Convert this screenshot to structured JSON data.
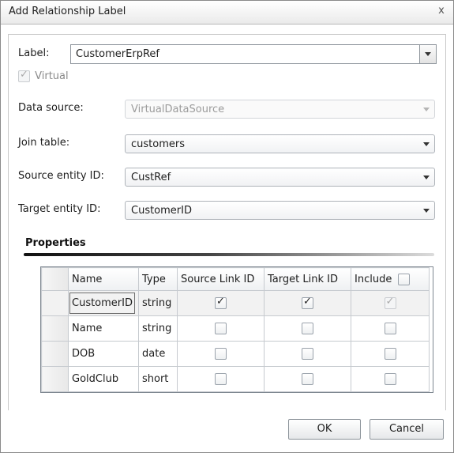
{
  "window": {
    "title": "Add Relationship Label",
    "close_glyph": "x"
  },
  "form": {
    "label_caption": "Label:",
    "label_value": "CustomerErpRef",
    "virtual_label": "Virtual",
    "virtual_checked": true,
    "data_source_caption": "Data source:",
    "data_source_value": "VirtualDataSource",
    "join_table_caption": "Join table:",
    "join_table_value": "customers",
    "source_entity_caption": "Source entity ID:",
    "source_entity_value": "CustRef",
    "target_entity_caption": "Target entity ID:",
    "target_entity_value": "CustomerID"
  },
  "properties": {
    "title": "Properties",
    "columns": [
      "Name",
      "Type",
      "Source Link ID",
      "Target Link ID",
      "Include"
    ],
    "rows": [
      {
        "name": "CustomerID",
        "type": "string",
        "source_link": true,
        "target_link": true,
        "include": true
      },
      {
        "name": "Name",
        "type": "string",
        "source_link": false,
        "target_link": false,
        "include": false
      },
      {
        "name": "DOB",
        "type": "date",
        "source_link": false,
        "target_link": false,
        "include": false
      },
      {
        "name": "GoldClub",
        "type": "short",
        "source_link": false,
        "target_link": false,
        "include": false
      }
    ]
  },
  "buttons": {
    "ok": "OK",
    "cancel": "Cancel"
  },
  "icons": {
    "check_glyph": "✓",
    "dropdown": "chevron-down-icon",
    "close": "close-icon"
  }
}
